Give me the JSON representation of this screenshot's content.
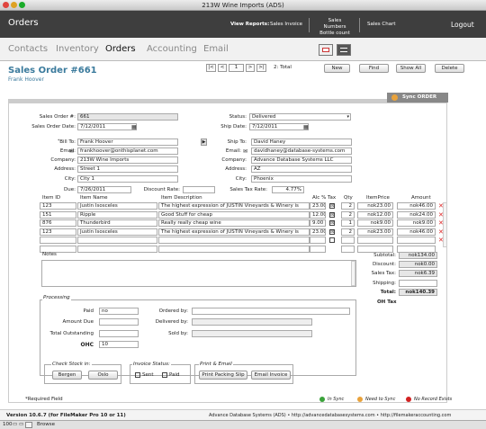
{
  "window": {
    "title": "213W Wine Imports (ADS)"
  },
  "topbar": {
    "title": "Orders",
    "view_reports": "View Reports:",
    "sales_invoice": "Sales Invoice",
    "sales_numbers": "Sales Numbers",
    "bottle_count": "Bottle count",
    "sales_chart": "Sales Chart",
    "logout": "Logout"
  },
  "nav": {
    "tabs": [
      "Contacts",
      "Inventory",
      "Orders",
      "Accounting",
      "Email"
    ]
  },
  "header": {
    "title": "Sales Order #661",
    "subtitle": "Frank Hoover",
    "record": "1",
    "total": "2: Total",
    "buttons": {
      "new": "New",
      "find": "Find",
      "show_all": "Show All",
      "delete": "Delete"
    },
    "sync": "Sync ORDER"
  },
  "form": {
    "sales_order_label": "Sales Order #:",
    "sales_order": "661",
    "order_date_label": "Sales Order Date:",
    "order_date": "7/12/2011",
    "status_label": "Status:",
    "status": "Delivered",
    "ship_date_label": "Ship Date:",
    "ship_date": "7/12/2011",
    "billto": {
      "label": "Bill To:",
      "name": "Frank Hoover",
      "email_label": "Email:",
      "email": "frankhoover@onthisplanet.com",
      "company_label": "Company:",
      "company": "213W Wine Imports",
      "address_label": "Address:",
      "address": "Street 1",
      "city_label": "City:",
      "city": "City 1"
    },
    "shipto": {
      "label": "Ship To:",
      "name": "David Haney",
      "email_label": "Email:",
      "email": "davidhaney@database-systems.com",
      "company_label": "Company:",
      "company": "Advance Database Systems LLC",
      "address_label": "Address:",
      "address": "AZ",
      "city_label": "City:",
      "city": "Phoenix"
    },
    "due_label": "Due:",
    "due": "7/26/2011",
    "discount_rate_label": "Discount Rate:",
    "discount_rate": "",
    "tax_rate_label": "Sales Tax Rate:",
    "tax_rate": "4.77%"
  },
  "items": {
    "headers": [
      "Item ID",
      "Item Name",
      "Item Description",
      "Alc %",
      "Tax",
      "Qty",
      "ItemPrice",
      "Amount"
    ],
    "rows": [
      {
        "id": "123",
        "name": "Justin Isosceles",
        "desc": "The highest expression of JUSTIN Vineyards & Winery is",
        "alc": "23.00",
        "tax": "☒",
        "qty": "2",
        "price": "nok23.00",
        "amount": "nok46.00"
      },
      {
        "id": "151",
        "name": "Ripple",
        "desc": "Good Stuff for cheap",
        "alc": "12.00",
        "tax": "☒",
        "qty": "2",
        "price": "nok12.00",
        "amount": "nok24.00"
      },
      {
        "id": "876",
        "name": "Thunderbird",
        "desc": "Really really cheap wine",
        "alc": "9.00",
        "tax": "☒",
        "qty": "1",
        "price": "nok9.00",
        "amount": "nok9.00"
      },
      {
        "id": "123",
        "name": "Justin Isosceles",
        "desc": "The highest expression of JUSTIN Vineyards & Winery is",
        "alc": "23.00",
        "tax": "☒",
        "qty": "2",
        "price": "nok23.00",
        "amount": "nok46.00"
      }
    ]
  },
  "notes": {
    "label": "Notes"
  },
  "totals": {
    "subtotal_label": "Subtotal:",
    "subtotal": "nok134.00",
    "discount_label": "Discount:",
    "discount": "nok0.00",
    "tax_label": "Sales Tax:",
    "tax": "nok6.39",
    "shipping_label": "Shipping:",
    "shipping": "",
    "total_label": "Total:",
    "total": "nok140.39",
    "oh_tax": "OH Tax"
  },
  "processing": {
    "title": "Processing",
    "paid_label": "Paid",
    "paid": "no",
    "amount_due_label": "Amount Due",
    "total_outstanding_label": "Total Outstanding",
    "ohc_label": "OHC",
    "ohc": "10",
    "ordered_by_label": "Ordered by:",
    "delivered_by_label": "Delivered by:",
    "sold_by_label": "Sold by:",
    "checkstock": {
      "title": "Check Stock in:",
      "bergen": "Bergen",
      "oslo": "Oslo"
    },
    "invoice_status": {
      "title": "Invoice Status:",
      "sent": "Sent",
      "paid": "Paid"
    },
    "print": {
      "title": "Print & Email",
      "packing": "Print Packing Slip",
      "email_invoice": "Email Invoice"
    }
  },
  "required": "*Required Field",
  "legend": {
    "in_sync": "In Sync",
    "need_sync": "Need to Sync",
    "no_record": "No Record Exists"
  },
  "colors": {
    "in_sync": "#3aa33a",
    "need_sync": "#e9a23b",
    "no_record": "#d22222",
    "accent": "#3a7a9c"
  },
  "footer": {
    "version": "Version 10.6.7 (for FileMaker Pro 10 or 11)",
    "company": "Advance Database Systems (ADS) • http://advancedatabasesystems.com • http://filemakeraccounting.com"
  },
  "statusbar": {
    "zoom": "100",
    "mode": "Browse"
  }
}
